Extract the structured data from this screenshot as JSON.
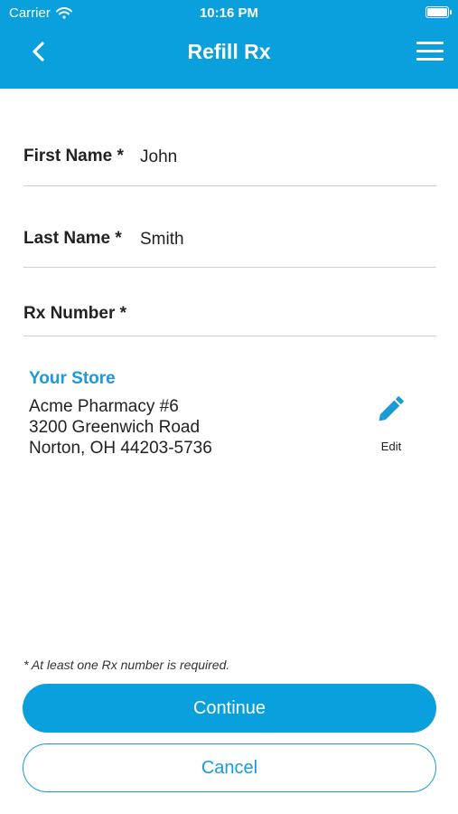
{
  "status_bar": {
    "carrier": "Carrier",
    "time": "10:16 PM",
    "wifi_icon": "wifi-icon",
    "battery_icon": "battery-icon"
  },
  "nav": {
    "title": "Refill Rx",
    "back_icon": "chevron-left-icon",
    "menu_icon": "hamburger-menu-icon"
  },
  "form": {
    "first_name": {
      "label": "First Name *",
      "value": "John"
    },
    "last_name": {
      "label": "Last Name *",
      "value": "Smith"
    },
    "rx_number": {
      "label": "Rx Number *",
      "value": ""
    }
  },
  "store": {
    "title": "Your Store",
    "address_lines": [
      "Acme Pharmacy #6",
      "3200 Greenwich Road",
      "Norton, OH 44203-5736"
    ],
    "edit_label": "Edit",
    "edit_icon": "pencil-icon"
  },
  "footnote": "* At least one Rx number is required.",
  "buttons": {
    "continue": "Continue",
    "cancel": "Cancel"
  },
  "colors": {
    "accent": "#0aa0dd",
    "link": "#1a9ad6"
  }
}
